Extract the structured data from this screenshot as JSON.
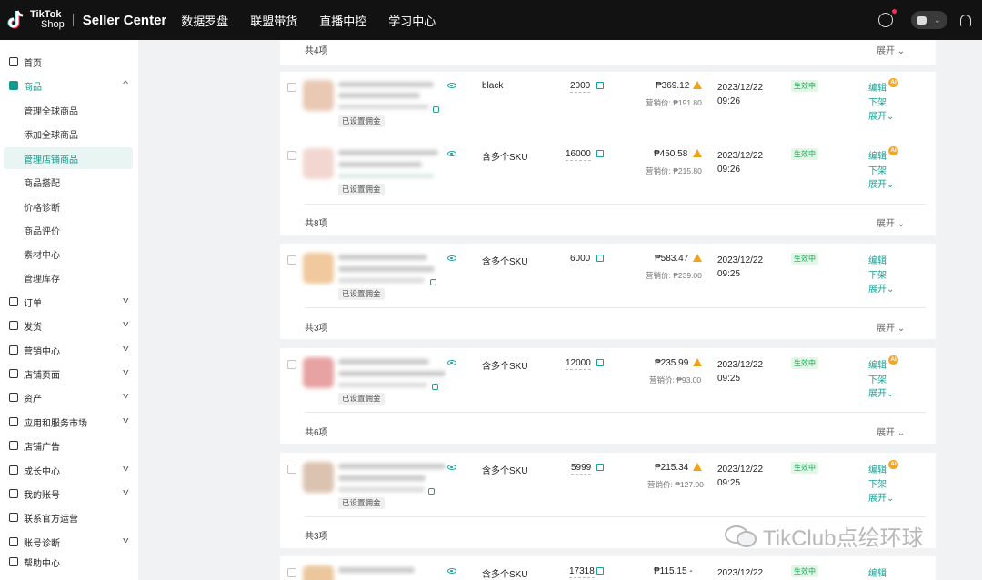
{
  "topbar": {
    "logo_line1": "TikTok",
    "logo_line2": "Shop",
    "app_title": "Seller Center",
    "nav": [
      "数据罗盘",
      "联盟带货",
      "直播中控",
      "学习中心"
    ]
  },
  "sidebar": {
    "home": "首页",
    "product": "商品",
    "product_sub": [
      "管理全球商品",
      "添加全球商品",
      "管理店铺商品",
      "商品搭配",
      "价格诊断",
      "商品评价",
      "素材中心",
      "管理库存"
    ],
    "sections": [
      "订单",
      "发货",
      "营销中心",
      "店铺页面",
      "资产",
      "应用和服务市场",
      "店铺广告",
      "成长中心",
      "我的账号",
      "联系官方运营",
      "账号诊断",
      "帮助中心"
    ]
  },
  "groups": {
    "g0_total": "共4项",
    "g1_total": "共8项",
    "g2_total": "共3项",
    "g3_total": "共6项",
    "g4_total": "共3项",
    "expand_label": "展开"
  },
  "rows": [
    {
      "sku": "black",
      "stock": "2000",
      "price": "₱369.12",
      "sale_price": "营销价: ₱191.80",
      "date": "2023/12/22",
      "time": "09:26",
      "status": "生效中",
      "tag": "已设置佣金",
      "ai": true
    },
    {
      "sku": "含多个SKU",
      "stock": "16000",
      "price": "₱450.58",
      "sale_price": "营销价: ₱215.80",
      "date": "2023/12/22",
      "time": "09:26",
      "status": "生效中",
      "tag": "已设置佣金",
      "ai": true
    },
    {
      "sku": "含多个SKU",
      "stock": "6000",
      "price": "₱583.47",
      "sale_price": "营销价: ₱239.00",
      "date": "2023/12/22",
      "time": "09:25",
      "status": "生效中",
      "tag": "已设置佣金",
      "ai": false
    },
    {
      "sku": "含多个SKU",
      "stock": "12000",
      "price": "₱235.99",
      "sale_price": "营销价: ₱93.00",
      "date": "2023/12/22",
      "time": "09:25",
      "status": "生效中",
      "tag": "已设置佣金",
      "ai": true
    },
    {
      "sku": "含多个SKU",
      "stock": "5999",
      "price": "₱215.34",
      "sale_price": "营销价: ₱127.00",
      "date": "2023/12/22",
      "time": "09:25",
      "status": "生效中",
      "tag": "已设置佣金",
      "ai": true
    },
    {
      "sku": "含多个SKU",
      "stock": "17318",
      "price": "₱115.15 -",
      "sale_price": "",
      "date": "2023/12/22",
      "time": "",
      "status": "生效中",
      "tag": "",
      "ai": false
    }
  ],
  "actions": {
    "edit": "编辑",
    "delist": "下架",
    "expand": "展开",
    "ai_badge": "AI"
  },
  "watermark": "TikClub点绘环球",
  "colors": {
    "accent": "#14a396",
    "topbar": "#121212",
    "warning": "#f2a11a",
    "status_green": "#10a64c"
  }
}
